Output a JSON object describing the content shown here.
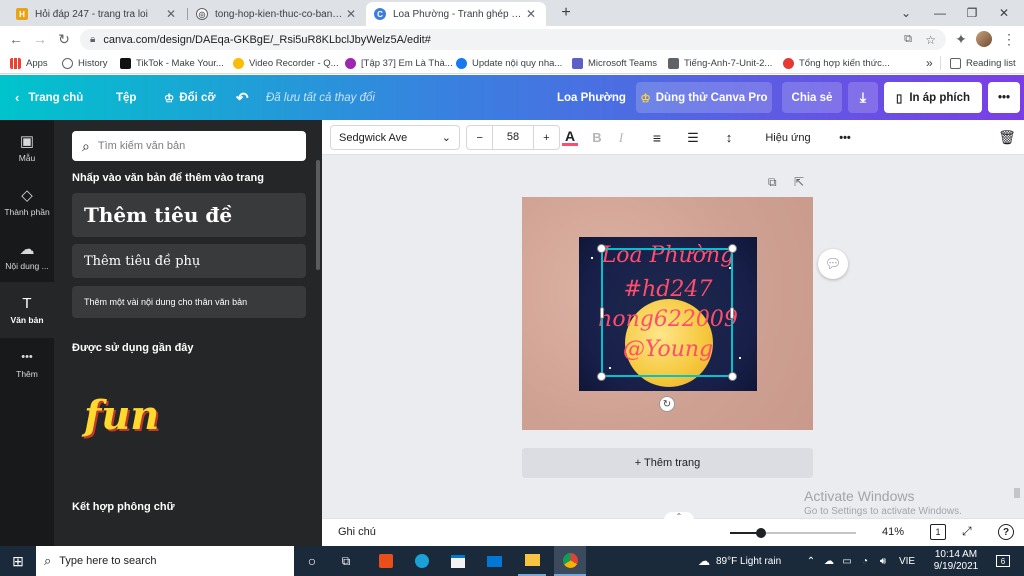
{
  "browser": {
    "tabs": [
      {
        "title": "Hỏi đáp 247 - trang tra loi",
        "favicon_color": "#e8a317",
        "favicon_glyph": "H"
      },
      {
        "title": "tong-hop-kien-thuc-co-ban-mon",
        "favicon_color": "#5f6368",
        "favicon_glyph": "◎"
      },
      {
        "title": "Loa Phường - Tranh ghép ảnh",
        "favicon_color": "#3d7de0",
        "favicon_glyph": "C"
      }
    ],
    "new_tab": "+",
    "url": "canva.com/design/DAEqa-GKBgE/_Rsi5uR8KLbclJbyWelz5A/edit#",
    "bookmarks": [
      {
        "label": "Apps",
        "color": "#ea4335"
      },
      {
        "label": "History",
        "color": "#5f6368"
      },
      {
        "label": "TikTok - Make Your...",
        "color": "#111111"
      },
      {
        "label": "Video Recorder - Q...",
        "color": "#fbbc05"
      },
      {
        "label": "[Tập 37] Em Là Thà...",
        "color": "#9c27b0"
      },
      {
        "label": "Update nội quy nha...",
        "color": "#1877f2"
      },
      {
        "label": "Microsoft Teams",
        "color": "#5b5fc7"
      },
      {
        "label": "Tiếng-Anh-7-Unit-2...",
        "color": "#5f6368"
      },
      {
        "label": "Tổng hợp kiến thức...",
        "color": "#e53935"
      }
    ],
    "more_bookmarks": "»",
    "reading_list": "Reading list"
  },
  "canva_header": {
    "home": "Trang chủ",
    "file": "Tệp",
    "resize": "Đổi cỡ",
    "saved_status": "Đã lưu tất cả thay đổi",
    "user_name": "Loa Phường",
    "try_pro": "Dùng thử Canva Pro",
    "share": "Chia sẻ",
    "print": "In áp phích",
    "more": "•••"
  },
  "rail": [
    {
      "label": "Mẫu",
      "icon": "template-icon",
      "glyph": "▣"
    },
    {
      "label": "Thành phần",
      "icon": "elements-icon",
      "glyph": "◇"
    },
    {
      "label": "Nội dung ...",
      "icon": "upload-icon",
      "glyph": "☁"
    },
    {
      "label": "Văn bản",
      "icon": "text-icon",
      "glyph": "T"
    },
    {
      "label": "Thêm",
      "icon": "more-icon",
      "glyph": "•••"
    }
  ],
  "panel": {
    "search_placeholder": "Tìm kiếm văn bản",
    "click_hint": "Nhấp vào văn bản để thêm vào trang",
    "add_heading": "Thêm tiêu đề",
    "add_subheading": "Thêm tiêu đề phụ",
    "add_body": "Thêm một vài nội dung cho thân văn bản",
    "recent_title": "Được sử dụng gần đây",
    "recent_sample": "fun",
    "combos_title": "Kết hợp phông chữ"
  },
  "toolbar": {
    "font": "Sedgwick Ave",
    "minus": "−",
    "font_size": "58",
    "plus": "+",
    "text_color_letter": "A",
    "bold": "B",
    "italic": "I",
    "effects": "Hiệu ứng",
    "more": "•••"
  },
  "canvas": {
    "overlay_lines": [
      "Loa Phường",
      "#hd247",
      "hong622009",
      "@Young"
    ],
    "add_page": "+ Thêm trang"
  },
  "status": {
    "notes": "Ghi chú",
    "zoom_percent": "41%",
    "zoom_level": 0.41,
    "page_count": "1"
  },
  "watermark": {
    "title": "Activate Windows",
    "subtitle": "Go to Settings to activate Windows."
  },
  "taskbar": {
    "search_placeholder": "Type here to search",
    "weather": "89°F  Light rain",
    "language": "VIE",
    "time": "10:14 AM",
    "date": "9/19/2021",
    "notifications": "6"
  }
}
